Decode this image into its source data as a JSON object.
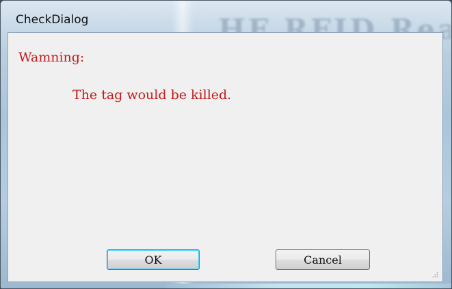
{
  "window": {
    "title": "CheckDialog",
    "background_window_text": "HF RFID Reader"
  },
  "content": {
    "warning_label": "Wamning:",
    "message": "The tag would be killed."
  },
  "buttons": {
    "ok_label": "OK",
    "cancel_label": "Cancel"
  },
  "colors": {
    "warning_text": "#c41a1a",
    "client_bg": "#f0f0f0",
    "default_button_border": "#3c7fb1"
  }
}
